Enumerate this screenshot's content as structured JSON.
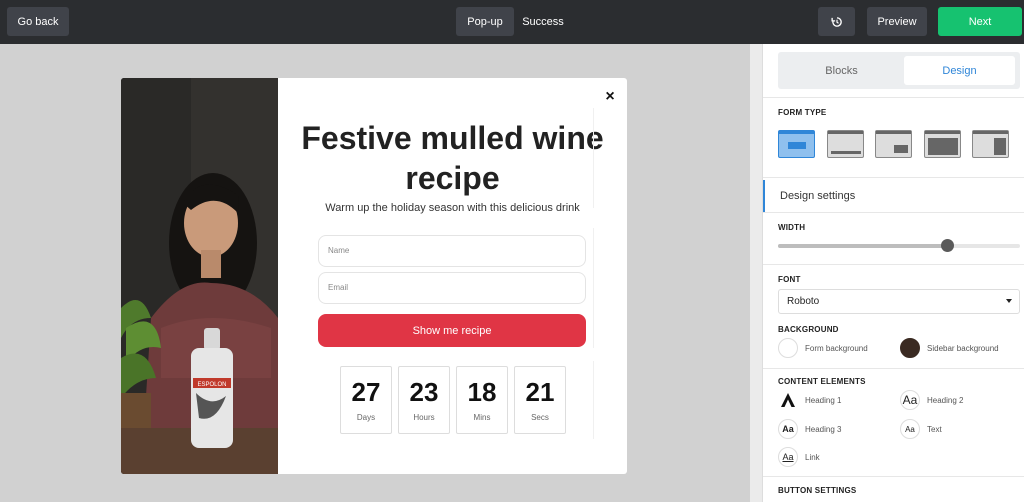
{
  "topbar": {
    "go_back": "Go back",
    "tab_popup": "Pop-up",
    "tab_success": "Success",
    "preview": "Preview",
    "next": "Next"
  },
  "popup": {
    "headline": "Festive mulled wine recipe",
    "subheading": "Warm up the holiday season with this delicious drink",
    "name_placeholder": "Name",
    "email_placeholder": "Email",
    "cta_label": "Show me recipe",
    "countdown": [
      {
        "value": "27",
        "unit": "Days"
      },
      {
        "value": "23",
        "unit": "Hours"
      },
      {
        "value": "18",
        "unit": "Mins"
      },
      {
        "value": "21",
        "unit": "Secs"
      }
    ],
    "bottle_label": "ESPOLON"
  },
  "panel": {
    "tab_blocks": "Blocks",
    "tab_design": "Design",
    "form_type_title": "FORM TYPE",
    "design_settings": "Design settings",
    "width_title": "WIDTH",
    "width_value": 0.7,
    "font_title": "FONT",
    "font_value": "Roboto",
    "background_title": "BACKGROUND",
    "form_background": "Form background",
    "sidebar_background": "Sidebar background",
    "content_title": "CONTENT ELEMENTS",
    "heading1": "Heading 1",
    "heading2": "Heading 2",
    "heading3": "Heading 3",
    "text": "Text",
    "link": "Link",
    "button_settings": "BUTTON SETTINGS"
  },
  "colors": {
    "accent": "#2f86d8",
    "next_green": "#16c270",
    "cta_red": "#e03545"
  }
}
